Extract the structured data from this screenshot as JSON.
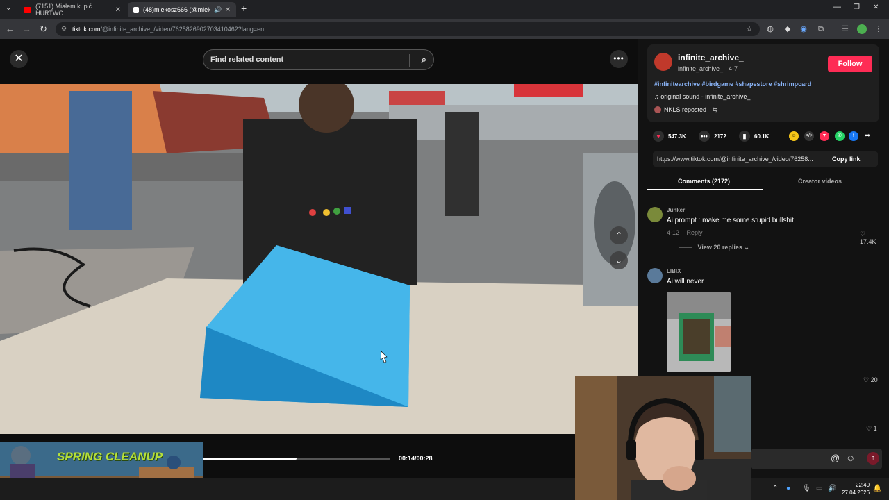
{
  "browser": {
    "tabs": [
      {
        "label": "(7151) Miałem kupić HURTWO",
        "favicon_color": "#ff0000",
        "active": false
      },
      {
        "label": "(48)mlekosz666 (@mlekosz",
        "favicon_color": "#ffffff",
        "active": true
      }
    ],
    "new_tab_label": "+",
    "url_host": "tiktok.com",
    "url_path": "/@infinite_archive_/video/7625826902703410462?lang=en"
  },
  "video": {
    "close_label": "✕",
    "search_placeholder": "Find related content",
    "more_label": "•••",
    "time": "00:14/00:28",
    "progress": 0.5,
    "thumbnail_title": "SPRING CLEANUP"
  },
  "post": {
    "username": "infinite_archive_",
    "subline": "infinite_archive_ · 4-7",
    "follow_label": "Follow",
    "hashtags": "#infinitearchive #birdgame #shapestore #shrimpcard",
    "sound": "♫  original sound - infinite_archive_",
    "repost": "NKLS reposted",
    "likes": "547.3K",
    "comments": "2172",
    "saves": "60.1K",
    "link": "https://www.tiktok.com/@infinite_archive_/video/76258...",
    "copy_label": "Copy link"
  },
  "tabs": {
    "comments": "Comments (2172)",
    "creator": "Creator videos"
  },
  "comments": [
    {
      "name": "Junker",
      "text": "Ai prompt : make me some stupid bullshit",
      "date": "4-12",
      "reply": "Reply",
      "likes": "17.4K",
      "replies": "View 20 replies ⌄"
    },
    {
      "name": "LIBIX",
      "text": "Ai will never",
      "likes": "20"
    }
  ],
  "third_like": "1",
  "taskbar": {
    "time": "22:40",
    "date": "27.04.2026"
  },
  "colors": {
    "accent": "#fe2c55",
    "hashtag": "#8ab4f8",
    "object_blue": "#2fa8e0"
  }
}
